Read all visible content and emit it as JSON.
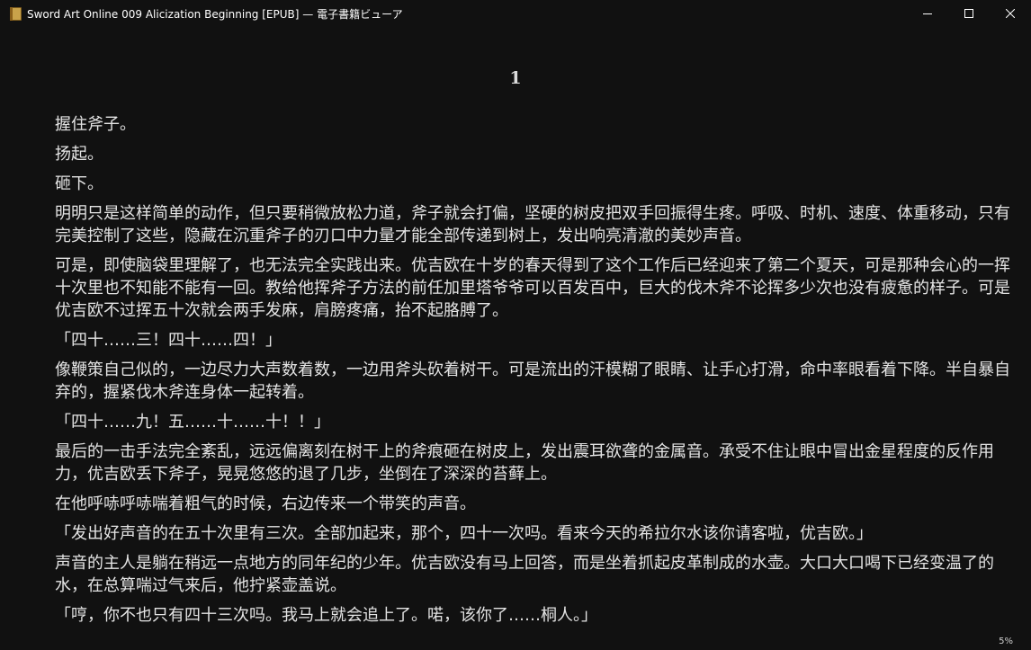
{
  "window": {
    "title": "Sword Art Online 009 Alicization Beginning [EPUB] — 電子書籍ビューア"
  },
  "controls": {
    "minimize_icon": "minimize-icon",
    "maximize_icon": "maximize-icon",
    "close_icon": "close-icon"
  },
  "chapter": {
    "heading": "1"
  },
  "paragraphs": [
    "握住斧子。",
    "扬起。",
    "砸下。",
    "明明只是这样简单的动作，但只要稍微放松力道，斧子就会打偏，坚硬的树皮把双手回振得生疼。呼吸、时机、速度、体重移动，只有完美控制了这些，隐藏在沉重斧子的刃口中力量才能全部传递到树上，发出响亮清澈的美妙声音。",
    "可是，即使脑袋里理解了，也无法完全实践出来。优吉欧在十岁的春天得到了这个工作后已经迎来了第二个夏天，可是那种会心的一挥十次里也不知能不能有一回。教给他挥斧子方法的前任加里塔爷爷可以百发百中，巨大的伐木斧不论挥多少次也没有疲惫的样子。可是优吉欧不过挥五十次就会两手发麻，肩膀疼痛，抬不起胳膊了。",
    "「四十……三！四十……四！」",
    "像鞭策自己似的，一边尽力大声数着数，一边用斧头砍着树干。可是流出的汗模糊了眼睛、让手心打滑，命中率眼看着下降。半自暴自弃的，握紧伐木斧连身体一起转着。",
    "「四十……九！五……十……十！！」",
    "最后的一击手法完全紊乱，远远偏离刻在树干上的斧痕砸在树皮上，发出震耳欲聋的金属音。承受不住让眼中冒出金星程度的反作用力，优吉欧丢下斧子，晃晃悠悠的退了几步，坐倒在了深深的苔藓上。",
    "在他呼哧呼哧喘着粗气的时候，右边传来一个带笑的声音。",
    "「发出好声音的在五十次里有三次。全部加起来，那个，四十一次吗。看来今天的希拉尔水该你请客啦，优吉欧。」",
    "声音的主人是躺在稍远一点地方的同年纪的少年。优吉欧没有马上回答，而是坐着抓起皮革制成的水壶。大口大口喝下已经变温了的水，在总算喘过气来后，他拧紧壶盖说。",
    "「哼，你不也只有四十三次吗。我马上就会追上了。喏，该你了……桐人。」"
  ],
  "progress": {
    "label": "5%",
    "percent": 5
  },
  "colors": {
    "background": "#111111",
    "text": "#e4e4e4",
    "titlebar_text": "#ffffff"
  }
}
